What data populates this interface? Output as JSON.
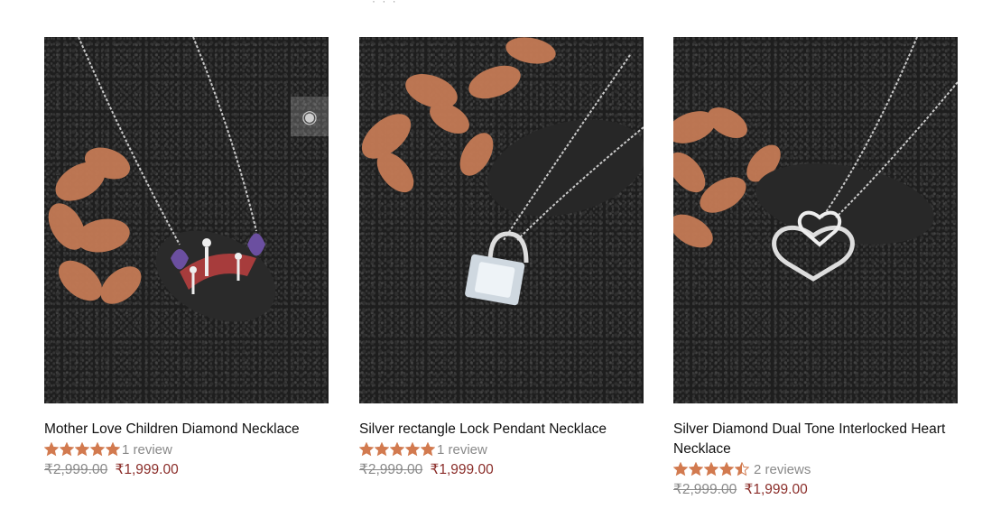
{
  "top_fragment": "· · ·",
  "colors": {
    "star": "#d27a4f",
    "sale_price": "#8b2e2a",
    "old_price": "#8a8a8a"
  },
  "products": [
    {
      "title": "Mother Love Children Diamond Necklace",
      "rating": 5,
      "reviews_label": "1 review",
      "old_price": "₹2,999.00",
      "price": "₹1,999.00",
      "image_icon": "necklace-photo"
    },
    {
      "title": "Silver rectangle Lock Pendant Necklace",
      "rating": 5,
      "reviews_label": "1 review",
      "old_price": "₹2,999.00",
      "price": "₹1,999.00",
      "image_icon": "necklace-photo"
    },
    {
      "title": "Silver Diamond Dual Tone Interlocked Heart Necklace",
      "rating": 4.5,
      "reviews_label": "2 reviews",
      "old_price": "₹2,999.00",
      "price": "₹1,999.00",
      "image_icon": "necklace-photo"
    }
  ],
  "quick_view_icon": "eye-icon"
}
